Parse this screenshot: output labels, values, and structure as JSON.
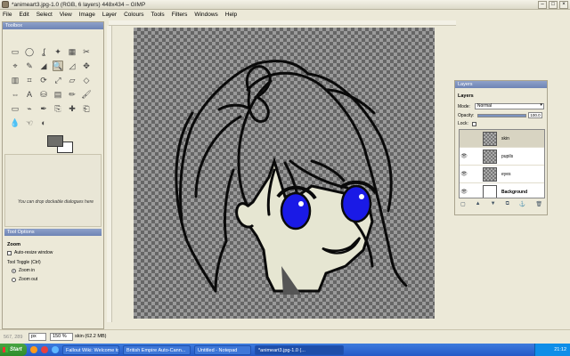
{
  "window": {
    "title": "*animeart3.jpg-1.0 (RGB, 6 layers) 448x434 – GIMP"
  },
  "menu": [
    "File",
    "Edit",
    "Select",
    "View",
    "Image",
    "Layer",
    "Colours",
    "Tools",
    "Filters",
    "Windows",
    "Help"
  ],
  "toolbox": {
    "title": "Toolbox",
    "dock_hint": "You can drop dockable dialogues here",
    "tools": [
      "rect-select-icon",
      "ellipse-select-icon",
      "free-select-icon",
      "fuzzy-select-icon",
      "select-by-color-icon",
      "scissors-icon",
      "foreground-select-icon",
      "paths-icon",
      "color-picker-icon",
      "zoom-icon",
      "measure-icon",
      "move-icon",
      "align-icon",
      "crop-icon",
      "rotate-icon",
      "scale-icon",
      "shear-icon",
      "perspective-icon",
      "flip-icon",
      "text-icon",
      "bucket-fill-icon",
      "blend-icon",
      "pencil-icon",
      "paintbrush-icon",
      "eraser-icon",
      "airbrush-icon",
      "ink-icon",
      "clone-icon",
      "heal-icon",
      "perspective-clone-icon",
      "blur-icon",
      "smudge-icon",
      "dodge-burn-icon"
    ],
    "tool_glyphs": [
      "▭",
      "◯",
      "ʆ",
      "✦",
      "▦",
      "✂",
      "⌖",
      "✎",
      "◢",
      "🔍",
      "◿",
      "✥",
      "▥",
      "⌗",
      "⟳",
      "⤢",
      "▱",
      "◇",
      "⇔",
      "A",
      "⛁",
      "▤",
      "✏",
      "🖌",
      "▭",
      "⌁",
      "✒",
      "⎘",
      "✚",
      "⎗",
      "💧",
      "☜",
      "◐"
    ],
    "active_tool_index": 9,
    "fg_color": "#6e6e6a",
    "bg_color": "#ffffff"
  },
  "tool_options": {
    "title": "Tool Options",
    "tool_name": "Zoom",
    "auto_resize_label": "Auto-resize window",
    "toggle_label": "Tool Toggle (Ctrl)",
    "zoom_in_label": "Zoom in",
    "zoom_out_label": "Zoom out"
  },
  "layers": {
    "dock_title": "Layers",
    "heading": "Layers",
    "mode_label": "Mode:",
    "mode_value": "Normal",
    "opacity_label": "Opacity:",
    "opacity_value": "100.0",
    "opacity_fraction": 1.0,
    "lock_label": "Lock:",
    "items": [
      {
        "name": "skin",
        "visible": false,
        "selected": true,
        "thumb": "checker"
      },
      {
        "name": "pupils",
        "visible": true,
        "selected": false,
        "thumb": "checker"
      },
      {
        "name": "eyes",
        "visible": true,
        "selected": false,
        "thumb": "checker"
      },
      {
        "name": "Background",
        "visible": true,
        "selected": false,
        "thumb": "white"
      }
    ]
  },
  "status": {
    "coords": "567, 289",
    "unit": "px",
    "zoom": "150 %",
    "text": "skin (62.2 MB)"
  },
  "taskbar": {
    "start_label": "Start",
    "tasks": [
      {
        "label": "Fallout Wiki: Welcome to ...",
        "active": false
      },
      {
        "label": "British Empire Auto-Cann...",
        "active": false
      },
      {
        "label": "Untitled - Notepad",
        "active": false
      },
      {
        "label": "*animeart3.jpg-1.0 (...",
        "active": true
      }
    ],
    "clock": "21:12"
  },
  "colors": {
    "eye_blue": "#1a1ae6",
    "skin": "#e6e6d2",
    "outline": "#0a0a0a"
  }
}
